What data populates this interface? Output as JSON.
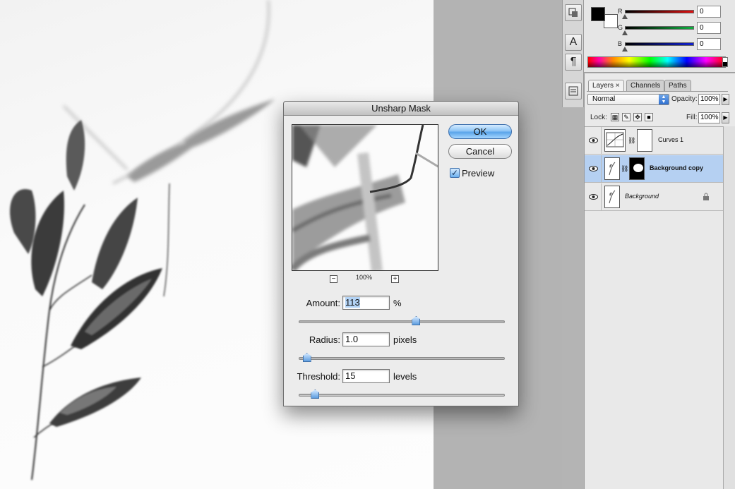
{
  "dialog": {
    "title": "Unsharp Mask",
    "ok_label": "OK",
    "cancel_label": "Cancel",
    "preview_label": "Preview",
    "preview_checked": true,
    "zoom_out_label": "−",
    "zoom_in_label": "+",
    "zoom_level": "100%",
    "amount": {
      "label": "Amount:",
      "value": "113",
      "unit": "%",
      "slider_fraction": 0.57
    },
    "radius": {
      "label": "Radius:",
      "value": "1.0",
      "unit": "pixels",
      "slider_fraction": 0.04
    },
    "threshold": {
      "label": "Threshold:",
      "value": "15",
      "unit": "levels",
      "slider_fraction": 0.08
    }
  },
  "color_panel": {
    "channels": [
      {
        "label": "R",
        "value": "0",
        "color": "#d42020"
      },
      {
        "label": "G",
        "value": "0",
        "color": "#20a040"
      },
      {
        "label": "B",
        "value": "0",
        "color": "#2030c0"
      }
    ],
    "foreground": "#000000",
    "background": "#ffffff"
  },
  "tools": [
    "character-icon",
    "paragraph-icon",
    "tool-presets-icon",
    "navigator-icon"
  ],
  "tool_glyphs": {
    "character": "A",
    "paragraph": "¶"
  },
  "layers_panel": {
    "tabs": [
      "Layers",
      "Channels",
      "Paths"
    ],
    "tab_close": "×",
    "blend_mode": "Normal",
    "opacity_label": "Opacity:",
    "opacity": "100%",
    "lock_label": "Lock:",
    "fill_label": "Fill:",
    "fill": "100%",
    "layers": [
      {
        "name": "Curves 1",
        "selected": false,
        "italic": false
      },
      {
        "name": "Background copy",
        "selected": true,
        "italic": false
      },
      {
        "name": "Background",
        "selected": false,
        "italic": true,
        "locked": true
      }
    ]
  },
  "colors": {
    "selection": "#b5d0f2",
    "button_blue": "#5aa4ea"
  }
}
